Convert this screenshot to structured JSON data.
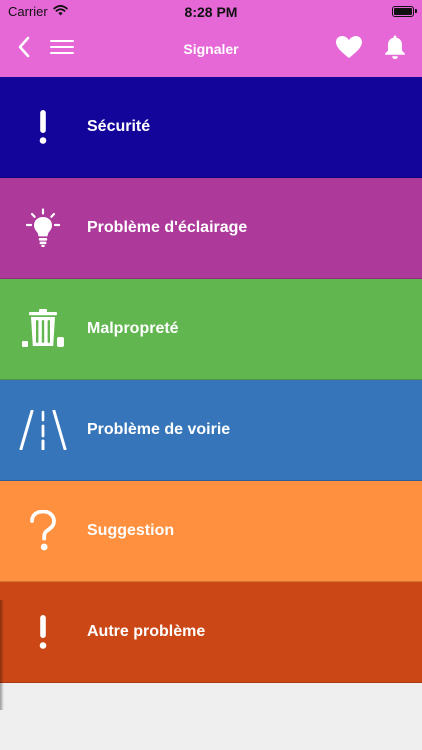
{
  "status_bar": {
    "carrier": "Carrier",
    "time": "8:28 PM"
  },
  "nav": {
    "title": "Signaler",
    "icons": {
      "back": "chevron-left-icon",
      "menu": "hamburger-menu-icon",
      "favorite": "heart-icon",
      "notifications": "bell-icon"
    }
  },
  "categories": [
    {
      "label": "Sécurité",
      "icon": "exclamation-icon",
      "color": "#13049a"
    },
    {
      "label": "Problème d'éclairage",
      "icon": "lightbulb-icon",
      "color": "#ad3a9a"
    },
    {
      "label": "Malpropreté",
      "icon": "trash-bin-icon",
      "color": "#61b64f"
    },
    {
      "label": "Problème de voirie",
      "icon": "road-icon",
      "color": "#3675b9"
    },
    {
      "label": "Suggestion",
      "icon": "question-mark-icon",
      "color": "#ff9040"
    },
    {
      "label": "Autre problème",
      "icon": "exclamation-icon",
      "color": "#cc4716"
    }
  ],
  "colors": {
    "header": "#e668d7",
    "background": "#efefef"
  }
}
